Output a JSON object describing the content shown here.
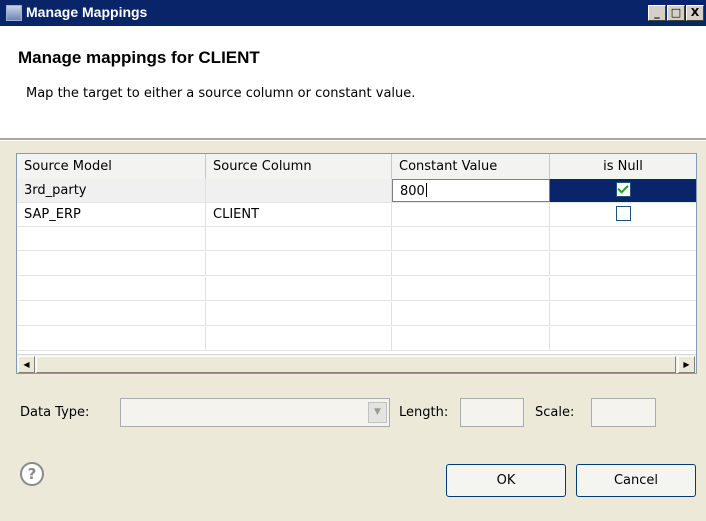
{
  "window": {
    "title": "Manage Mappings",
    "minimize": "_",
    "maximize": "□",
    "close": "X"
  },
  "header": {
    "heading": "Manage mappings for CLIENT",
    "description": "Map the target to either a source column or constant value."
  },
  "table": {
    "columns": [
      "Source Model",
      "Source Column",
      "Constant Value",
      "is Null"
    ],
    "rows": [
      {
        "source_model": "3rd_party",
        "source_column": "",
        "constant_value": "800",
        "is_null": true,
        "selected": true,
        "editing": true
      },
      {
        "source_model": "SAP_ERP",
        "source_column": "CLIENT",
        "constant_value": "",
        "is_null": false
      }
    ]
  },
  "data_type": {
    "label": "Data Type:",
    "value": ""
  },
  "length": {
    "label": "Length:",
    "value": ""
  },
  "scale": {
    "label": "Scale:",
    "value": ""
  },
  "buttons": {
    "help": "?",
    "ok": "OK",
    "cancel": "Cancel"
  },
  "icons": {
    "scroll_left": "◀",
    "scroll_right": "▶",
    "combo_arrow": "▼"
  }
}
